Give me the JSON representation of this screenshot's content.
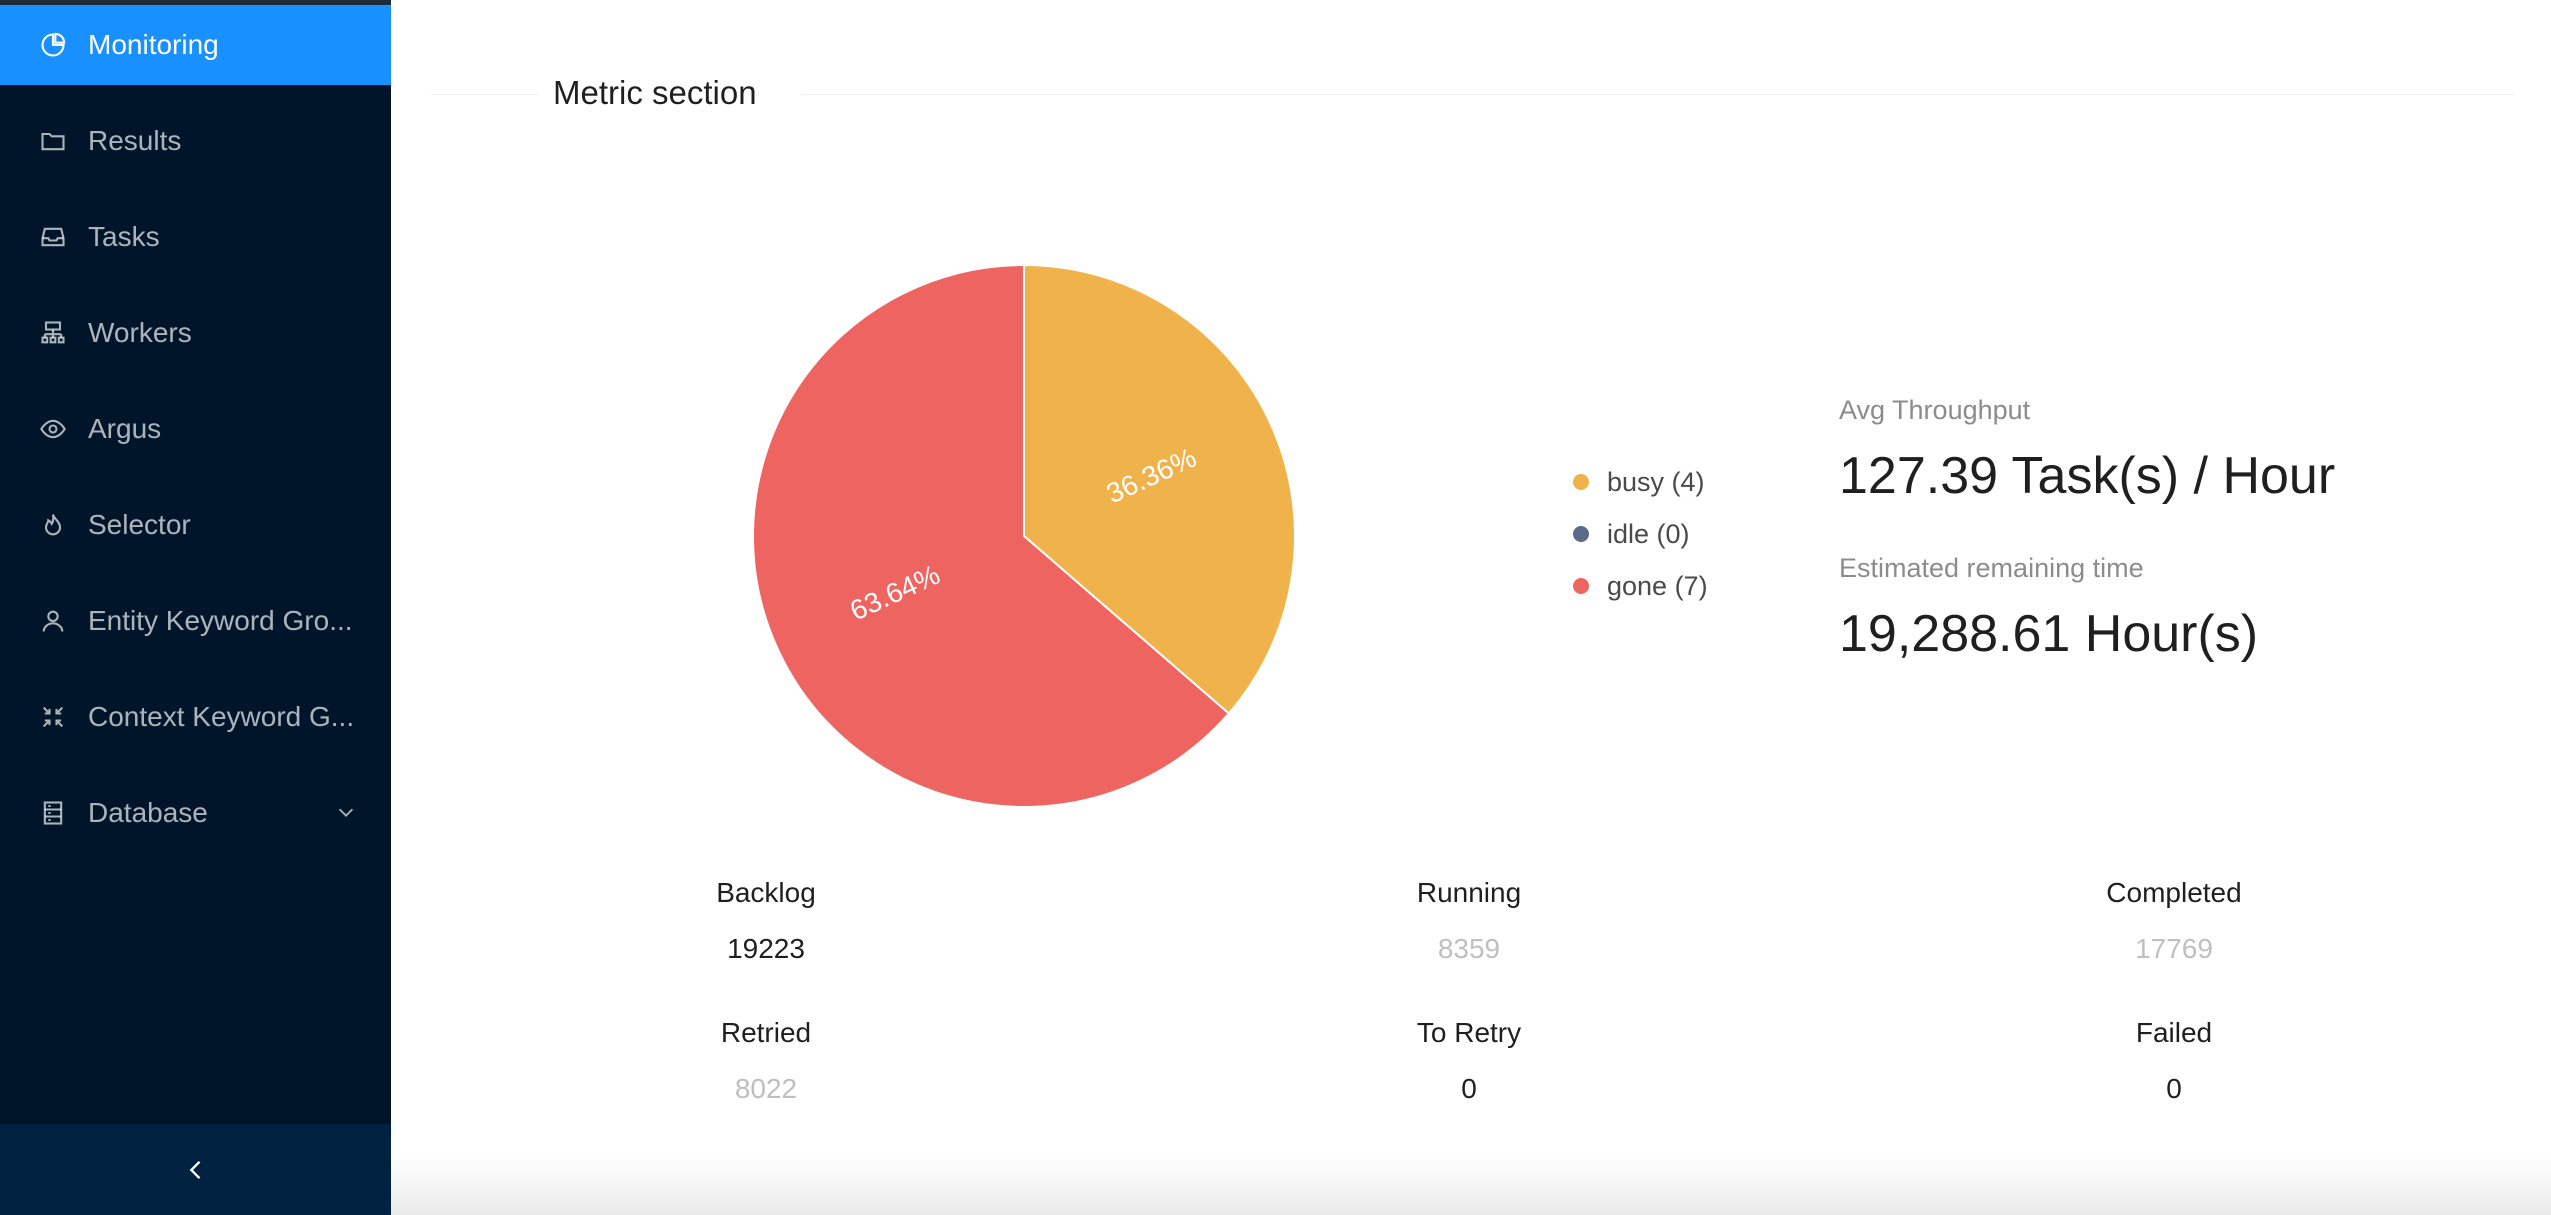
{
  "sidebar": {
    "items": [
      {
        "label": "Monitoring",
        "icon": "pie-chart-icon",
        "active": true
      },
      {
        "label": "Results",
        "icon": "folder-icon"
      },
      {
        "label": "Tasks",
        "icon": "inbox-icon"
      },
      {
        "label": "Workers",
        "icon": "cluster-icon"
      },
      {
        "label": "Argus",
        "icon": "eye-icon"
      },
      {
        "label": "Selector",
        "icon": "fire-icon"
      },
      {
        "label": "Entity Keyword Gro...",
        "icon": "user-icon"
      },
      {
        "label": "Context Keyword G...",
        "icon": "compress-icon"
      },
      {
        "label": "Database",
        "icon": "database-icon",
        "has_submenu": true
      }
    ],
    "collapse_icon": "chevron-left-icon",
    "accent_color": "#1890ff",
    "background": "#001529"
  },
  "main": {
    "section_title": "Metric section"
  },
  "chart_data": {
    "type": "pie",
    "categories": [
      "busy (4)",
      "idle (0)",
      "gone (7)"
    ],
    "values": [
      4,
      0,
      7
    ],
    "slice_labels": [
      "36.36%",
      "",
      "63.64%"
    ],
    "colors": [
      "#f0b24b",
      "#5b6b8a",
      "#ee6461"
    ],
    "legend_position": "right"
  },
  "legend": [
    {
      "label": "busy (4)",
      "color": "#f0b24b"
    },
    {
      "label": "idle (0)",
      "color": "#5b6b8a"
    },
    {
      "label": "gone (7)",
      "color": "#ee6461"
    }
  ],
  "kpis": {
    "throughput_label": "Avg Throughput",
    "throughput_value": "127.39 Task(s) / Hour",
    "remaining_label": "Estimated remaining time",
    "remaining_value": "19,288.61 Hour(s)"
  },
  "stats": {
    "backlog": {
      "label": "Backlog",
      "value": "19223"
    },
    "running": {
      "label": "Running",
      "value": "8359"
    },
    "completed": {
      "label": "Completed",
      "value": "17769"
    },
    "retried": {
      "label": "Retried",
      "value": "8022"
    },
    "to_retry": {
      "label": "To Retry",
      "value": "0"
    },
    "failed": {
      "label": "Failed",
      "value": "0"
    }
  }
}
